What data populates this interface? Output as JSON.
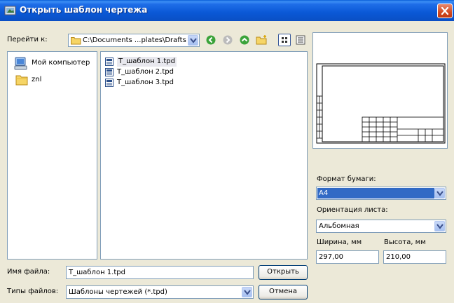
{
  "window": {
    "title": "Открыть шаблон чертежа"
  },
  "goto": {
    "label": "Перейти к:",
    "path": "C:\\Documents ...plates\\Drafts"
  },
  "places": [
    {
      "label": "Мой компьютер",
      "icon": "computer-icon"
    },
    {
      "label": "znl",
      "icon": "folder-icon"
    }
  ],
  "files": [
    {
      "name": "Т_шаблон 1.tpd",
      "selected": true
    },
    {
      "name": "Т_шаблон 2.tpd",
      "selected": false
    },
    {
      "name": "Т_шаблон 3.tpd",
      "selected": false
    }
  ],
  "filename": {
    "label": "Имя файла:",
    "value": "Т_шаблон 1.tpd"
  },
  "filetype": {
    "label": "Типы файлов:",
    "value": "Шаблоны чертежей (*.tpd)"
  },
  "buttons": {
    "open": "Открыть",
    "cancel": "Отмена"
  },
  "options": {
    "paper_format_label": "Формат бумаги:",
    "paper_format_value": "А4",
    "orientation_label": "Ориентация листа:",
    "orientation_value": "Альбомная",
    "width_label": "Ширина, мм",
    "height_label": "Высота, мм",
    "width_value": "297,00",
    "height_value": "210,00"
  },
  "colors": {
    "titlebar": "#0a58d6",
    "selection": "#316ac5",
    "dialog_bg": "#ece9d8"
  }
}
